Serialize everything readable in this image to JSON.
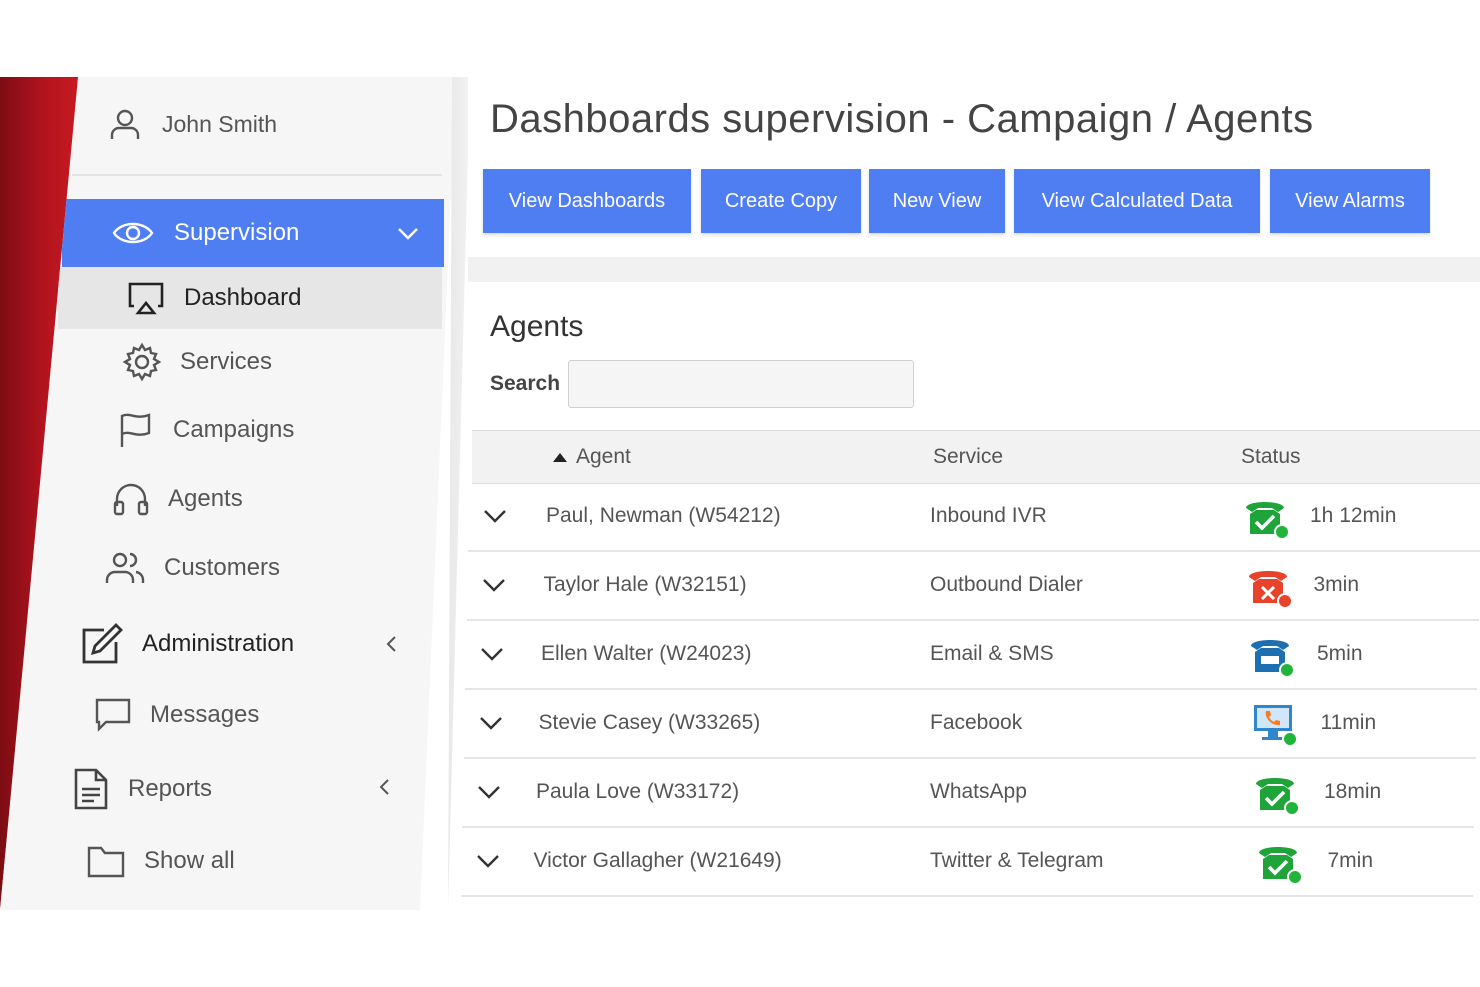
{
  "user": {
    "name": "John Smith",
    "icon": "user-icon"
  },
  "sidebar": {
    "supervision": {
      "label": "Supervision",
      "icon": "eye-icon"
    },
    "items": [
      {
        "label": "Dashboard",
        "icon": "monitor-icon"
      },
      {
        "label": "Services",
        "icon": "gear-icon"
      },
      {
        "label": "Campaigns",
        "icon": "flag-icon"
      },
      {
        "label": "Agents",
        "icon": "headset-icon"
      },
      {
        "label": "Customers",
        "icon": "users-icon"
      },
      {
        "label": "Administration",
        "icon": "edit-icon"
      },
      {
        "label": "Messages",
        "icon": "message-icon"
      },
      {
        "label": "Reports",
        "icon": "document-icon"
      },
      {
        "label": "Show all",
        "icon": "folder-icon"
      }
    ]
  },
  "header": {
    "title": "Dashboards supervision - Campaign / Agents",
    "buttons": [
      "View Dashboards",
      "Create Copy",
      "New View",
      "View Calculated Data",
      "View Alarms"
    ]
  },
  "agents_panel": {
    "title": "Agents",
    "search_label": "Search",
    "search_value": "",
    "columns": {
      "agent": "Agent",
      "service": "Service",
      "status": "Status"
    },
    "rows": [
      {
        "agent": "Paul, Newman (W54212)",
        "service": "Inbound IVR",
        "status_time": "1h 12min",
        "status_icon": "phone-check-icon",
        "status_color": "#1fa43a"
      },
      {
        "agent": "Taylor Hale (W32151)",
        "service": "Outbound Dialer",
        "status_time": "3min",
        "status_icon": "phone-x-icon",
        "status_color": "#e8432a"
      },
      {
        "agent": "Ellen Walter (W24023)",
        "service": "Email & SMS",
        "status_time": "5min",
        "status_icon": "phone-busy-icon",
        "status_color": "#1c6fb0"
      },
      {
        "agent": "Stevie Casey (W33265)",
        "service": "Facebook",
        "status_time": "11min",
        "status_icon": "monitor-phone-icon",
        "status_color": "#2f86c8"
      },
      {
        "agent": "Paula Love (W33172)",
        "service": "WhatsApp",
        "status_time": "18min",
        "status_icon": "phone-check-icon",
        "status_color": "#1fa43a"
      },
      {
        "agent": "Victor Gallagher (W21649)",
        "service": "Twitter & Telegram",
        "status_time": "7min",
        "status_icon": "phone-check-icon",
        "status_color": "#1fa43a"
      }
    ]
  },
  "colors": {
    "accent": "#4f7df2",
    "brand_red": "#b3141e",
    "online_dot": "#21b43a"
  }
}
